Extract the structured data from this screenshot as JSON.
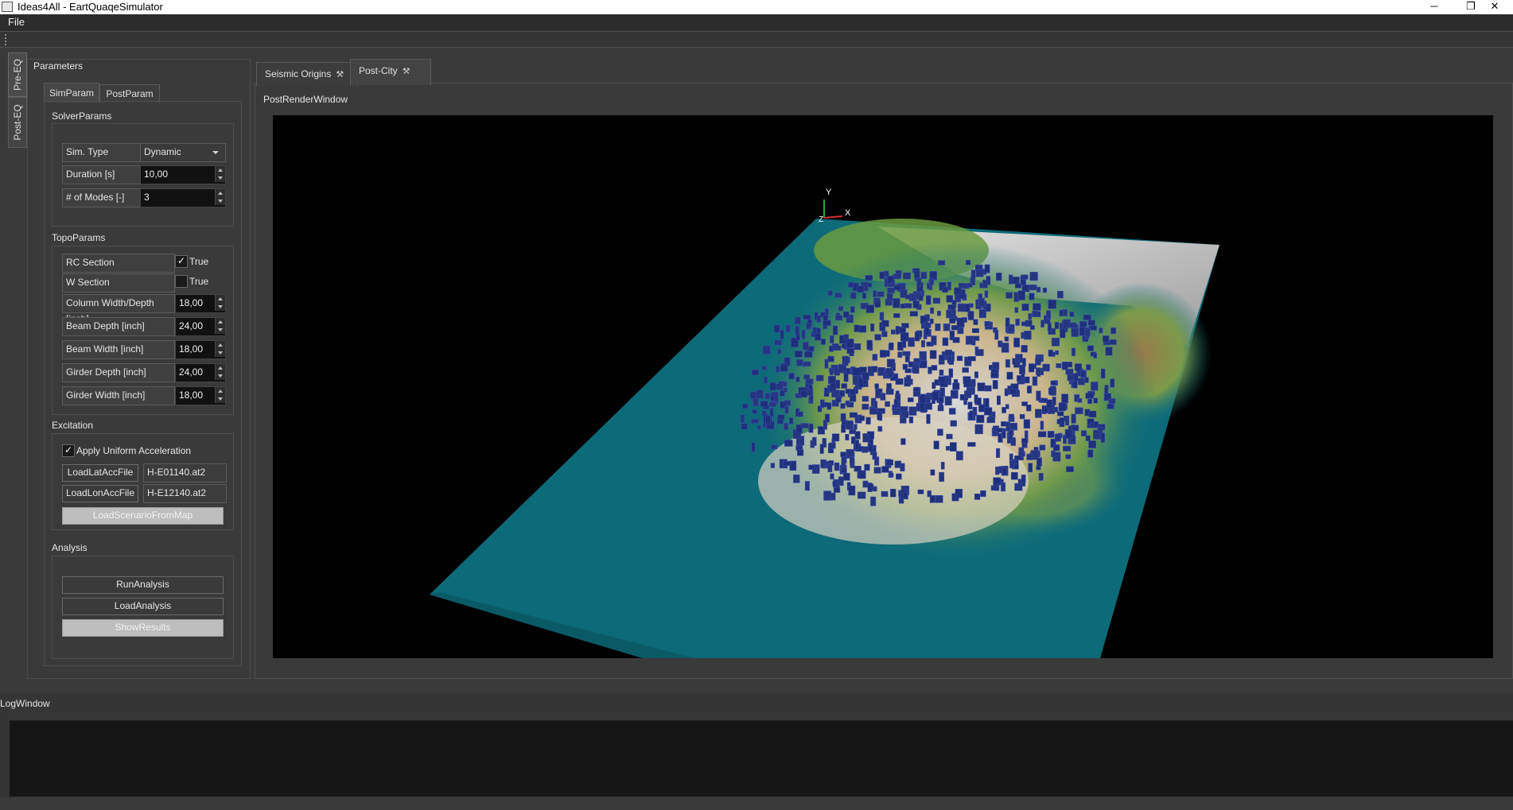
{
  "window": {
    "title": "Ideas4All - EartQuaqeSimulator",
    "minimize": "─",
    "restore": "❐",
    "close": "✕"
  },
  "menu": {
    "file": "File"
  },
  "sidetabs": {
    "pre": "Pre-EQ",
    "post": "Post-EQ"
  },
  "params": {
    "title": "Parameters",
    "tabs": [
      "SimParam",
      "PostParam"
    ],
    "solver": {
      "title": "SolverParams",
      "sim_type_label": "Sim. Type",
      "sim_type_value": "Dynamic",
      "duration_label": "Duration [s]",
      "duration_value": "10,00",
      "modes_label": "# of Modes [-]",
      "modes_value": "3"
    },
    "topo": {
      "title": "TopoParams",
      "rc_label": "RC Section",
      "rc_checked_text": "True",
      "rc_check": "✓",
      "w_label": "W Section",
      "w_checked_text": "True",
      "col_label": "Column Width/Depth [inch]",
      "col_value": "18,00",
      "beam_depth_label": "Beam Depth [inch]",
      "beam_depth_value": "24,00",
      "beam_width_label": "Beam Width [inch]",
      "beam_width_value": "18,00",
      "girder_depth_label": "Girder Depth [inch]",
      "girder_depth_value": "24,00",
      "girder_width_label": "Girder Width [inch]",
      "girder_width_value": "18,00"
    },
    "excitation": {
      "title": "Excitation",
      "uniform_check": "✓",
      "uniform_label": "Apply Uniform Acceleration",
      "lat_button": "LoadLatAccFile",
      "lat_file": "H-E01140.at2",
      "lon_button": "LoadLonAccFile",
      "lon_file": "H-E12140.at2",
      "scenario_button": "LoadScenarioFromMap"
    },
    "analysis": {
      "title": "Analysis",
      "run_button": "RunAnalysis",
      "load_button": "LoadAnalysis",
      "show_button": "ShowResults"
    }
  },
  "main": {
    "tabs": [
      {
        "label": "Seismic Origins",
        "pin": "⚒"
      },
      {
        "label": "Post-City",
        "pin": "⚒"
      }
    ],
    "render_title": "PostRenderWindow",
    "axes": {
      "x": "X",
      "y": "Y",
      "z": "Z"
    }
  },
  "log": {
    "title": "LogWindow"
  },
  "colors": {
    "water": "#0e6f7d",
    "terrain_green": "#6a9a40",
    "terrain_brown": "#9a7a4a",
    "terrain_snow": "#d8d8d8",
    "buildings": "#1f2f7a"
  }
}
